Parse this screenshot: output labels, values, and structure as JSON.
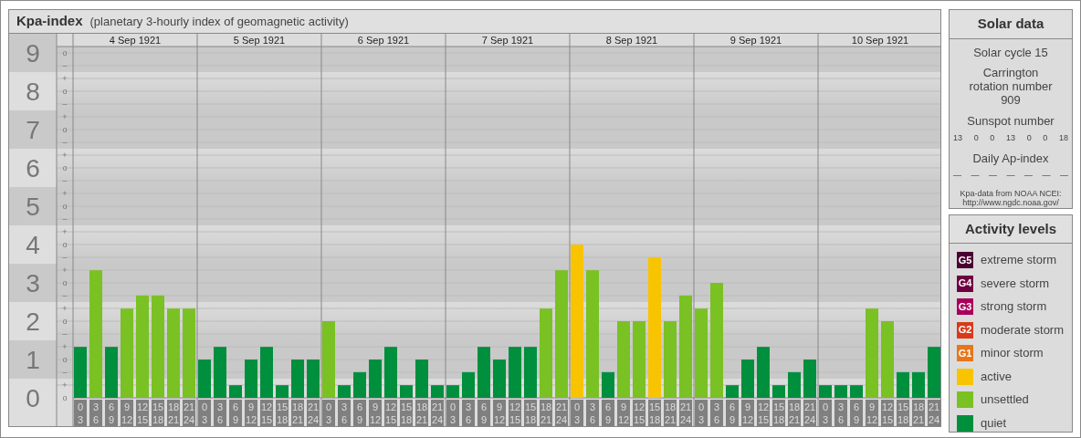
{
  "kp_panel": {
    "title": "Kpa-index",
    "subtitle": "(planetary 3-hourly index of geomagnetic activity)",
    "sub_marks": [
      "o",
      "–",
      "+",
      "o",
      "–",
      "+",
      "o",
      "–",
      "+",
      "o",
      "–",
      "+",
      "o",
      "–",
      "+",
      "o",
      "–",
      "+",
      "o",
      "–",
      "+",
      "o",
      "–",
      "+",
      "o",
      "–",
      "+",
      "o"
    ],
    "days": [
      {
        "date": "4 Sep 1921",
        "slots": [
          [
            "0",
            "3"
          ],
          [
            "3",
            "6"
          ],
          [
            "6",
            "9"
          ],
          [
            "9",
            "12"
          ],
          [
            "12",
            "15"
          ],
          [
            "15",
            "18"
          ],
          [
            "18",
            "21"
          ],
          [
            "21",
            "24"
          ]
        ]
      },
      {
        "date": "5 Sep 1921",
        "slots": [
          [
            "0",
            "3"
          ],
          [
            "3",
            "6"
          ],
          [
            "6",
            "9"
          ],
          [
            "9",
            "12"
          ],
          [
            "12",
            "15"
          ],
          [
            "15",
            "18"
          ],
          [
            "18",
            "21"
          ],
          [
            "21",
            "24"
          ]
        ]
      },
      {
        "date": "6 Sep 1921",
        "slots": [
          [
            "0",
            "3"
          ],
          [
            "3",
            "6"
          ],
          [
            "6",
            "9"
          ],
          [
            "9",
            "12"
          ],
          [
            "12",
            "15"
          ],
          [
            "15",
            "18"
          ],
          [
            "18",
            "21"
          ],
          [
            "21",
            "24"
          ]
        ]
      },
      {
        "date": "7 Sep 1921",
        "slots": [
          [
            "0",
            "3"
          ],
          [
            "3",
            "6"
          ],
          [
            "6",
            "9"
          ],
          [
            "9",
            "12"
          ],
          [
            "12",
            "15"
          ],
          [
            "15",
            "18"
          ],
          [
            "18",
            "21"
          ],
          [
            "21",
            "24"
          ]
        ]
      },
      {
        "date": "8 Sep 1921",
        "slots": [
          [
            "0",
            "3"
          ],
          [
            "3",
            "6"
          ],
          [
            "6",
            "9"
          ],
          [
            "9",
            "12"
          ],
          [
            "12",
            "15"
          ],
          [
            "15",
            "18"
          ],
          [
            "18",
            "21"
          ],
          [
            "21",
            "24"
          ]
        ]
      },
      {
        "date": "9 Sep 1921",
        "slots": [
          [
            "0",
            "3"
          ],
          [
            "3",
            "6"
          ],
          [
            "6",
            "9"
          ],
          [
            "9",
            "12"
          ],
          [
            "12",
            "15"
          ],
          [
            "15",
            "18"
          ],
          [
            "18",
            "21"
          ],
          [
            "21",
            "24"
          ]
        ]
      },
      {
        "date": "10 Sep 1921",
        "slots": [
          [
            "0",
            "3"
          ],
          [
            "3",
            "6"
          ],
          [
            "6",
            "9"
          ],
          [
            "9",
            "12"
          ],
          [
            "12",
            "15"
          ],
          [
            "15",
            "18"
          ],
          [
            "18",
            "21"
          ],
          [
            "21",
            "24"
          ]
        ]
      }
    ],
    "chart_data": {
      "type": "bar",
      "grid": true,
      "ylim": [
        0,
        9.1667
      ],
      "yticks": [
        {
          "value": 9,
          "label": "9"
        },
        {
          "value": 8,
          "label": "8"
        },
        {
          "value": 7,
          "label": "7"
        },
        {
          "value": 6,
          "label": "6"
        },
        {
          "value": 5,
          "label": "5"
        },
        {
          "value": 4,
          "label": "4"
        },
        {
          "value": 3,
          "label": "3"
        },
        {
          "value": 2,
          "label": "2"
        },
        {
          "value": 1,
          "label": "1"
        },
        {
          "value": 0,
          "label": "0"
        }
      ],
      "series": [
        {
          "values": [
            1.33,
            3.33,
            1.33,
            2.33,
            2.67,
            2.67,
            2.33,
            2.33,
            1,
            1.33,
            0.33,
            1,
            1.33,
            0.33,
            1,
            1,
            2,
            0.33,
            0.67,
            1,
            1.33,
            0.33,
            1,
            0.33,
            0.33,
            0.67,
            1.33,
            1,
            1.33,
            1.33,
            2.33,
            3.33,
            4,
            3.33,
            0.67,
            2,
            2,
            3.67,
            2,
            2.67,
            2.33,
            3,
            0.33,
            1,
            1.33,
            0.33,
            0.67,
            1,
            0.33,
            0.33,
            0.33,
            2.33,
            2,
            0.67,
            0.67,
            1.33
          ],
          "colors": [
            "#008f3d",
            "#7ac123",
            "#008f3d",
            "#7ac123",
            "#7ac123",
            "#7ac123",
            "#7ac123",
            "#7ac123",
            "#008f3d",
            "#008f3d",
            "#008f3d",
            "#008f3d",
            "#008f3d",
            "#008f3d",
            "#008f3d",
            "#008f3d",
            "#7ac123",
            "#008f3d",
            "#008f3d",
            "#008f3d",
            "#008f3d",
            "#008f3d",
            "#008f3d",
            "#008f3d",
            "#008f3d",
            "#008f3d",
            "#008f3d",
            "#008f3d",
            "#008f3d",
            "#008f3d",
            "#7ac123",
            "#7ac123",
            "#f8c400",
            "#7ac123",
            "#008f3d",
            "#7ac123",
            "#7ac123",
            "#f8c400",
            "#7ac123",
            "#7ac123",
            "#7ac123",
            "#7ac123",
            "#008f3d",
            "#008f3d",
            "#008f3d",
            "#008f3d",
            "#008f3d",
            "#008f3d",
            "#008f3d",
            "#008f3d",
            "#008f3d",
            "#7ac123",
            "#7ac123",
            "#008f3d",
            "#008f3d",
            "#008f3d"
          ]
        }
      ]
    }
  },
  "solar_data": {
    "title": "Solar data",
    "cycle": "Solar cycle 15",
    "carrington": "Carrington rotation number 909",
    "sunspot_title": "Sunspot number",
    "sunspot_values": [
      "13",
      "0",
      "0",
      "13",
      "0",
      "0",
      "18"
    ],
    "ap_title": "Daily Ap-index",
    "ap_values": [
      "—",
      "—",
      "—",
      "—",
      "—",
      "—",
      "—"
    ],
    "source": "Kpa-data from NOAA NCEI:",
    "source_url": "http://www.ngdc.noaa.gov/"
  },
  "activity_levels": {
    "title": "Activity levels",
    "items": [
      {
        "badge": "G5",
        "label": "extreme storm",
        "color": "#4a0030"
      },
      {
        "badge": "G4",
        "label": "severe storm",
        "color": "#6e0040"
      },
      {
        "badge": "G3",
        "label": "strong storm",
        "color": "#a8005a"
      },
      {
        "badge": "G2",
        "label": "moderate storm",
        "color": "#d93a1a"
      },
      {
        "badge": "G1",
        "label": "minor storm",
        "color": "#e8761a"
      },
      {
        "label": "active",
        "color": "#f8c400"
      },
      {
        "label": "unsettled",
        "color": "#7ac123"
      },
      {
        "label": "quiet",
        "color": "#008f3d"
      }
    ]
  }
}
